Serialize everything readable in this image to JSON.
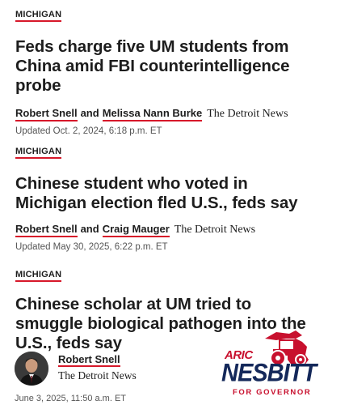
{
  "articles": [
    {
      "section": "MICHIGAN",
      "headline_lines": [
        "Feds charge five UM students from",
        "China amid FBI counterintelligence",
        "probe"
      ],
      "author1": "Robert Snell",
      "and": "and",
      "author2": "Melissa Nann Burke",
      "outlet": "The Detroit News",
      "updated": "Updated Oct. 2, 2024, 6:18 p.m. ET"
    },
    {
      "section": "MICHIGAN",
      "headline_lines": [
        "Chinese student who voted in",
        "Michigan election fled U.S., feds say"
      ],
      "author1": "Robert Snell",
      "and": "and",
      "author2": "Craig Mauger",
      "outlet": "The Detroit News",
      "updated": "Updated May 30, 2025, 6:22 p.m. ET"
    },
    {
      "section": "MICHIGAN",
      "headline_lines": [
        "Chinese scholar at UM tried to",
        "smuggle biological pathogen into the",
        "U.S., feds say"
      ],
      "author": "Robert Snell",
      "outlet": "The Detroit News",
      "date_partial": "June 3, 2025, 11:50 a.m. ET"
    }
  ],
  "ad": {
    "line1": "ARIC",
    "line2": "NESBITT",
    "line3": "FOR GOVERNOR",
    "colors": {
      "red": "#c8102e",
      "navy": "#14285a"
    },
    "icons": [
      "michigan-map-icon",
      "tractor-icon"
    ]
  },
  "colors": {
    "accent": "#d7182a",
    "text": "#1d1d1d",
    "muted": "#555555"
  }
}
